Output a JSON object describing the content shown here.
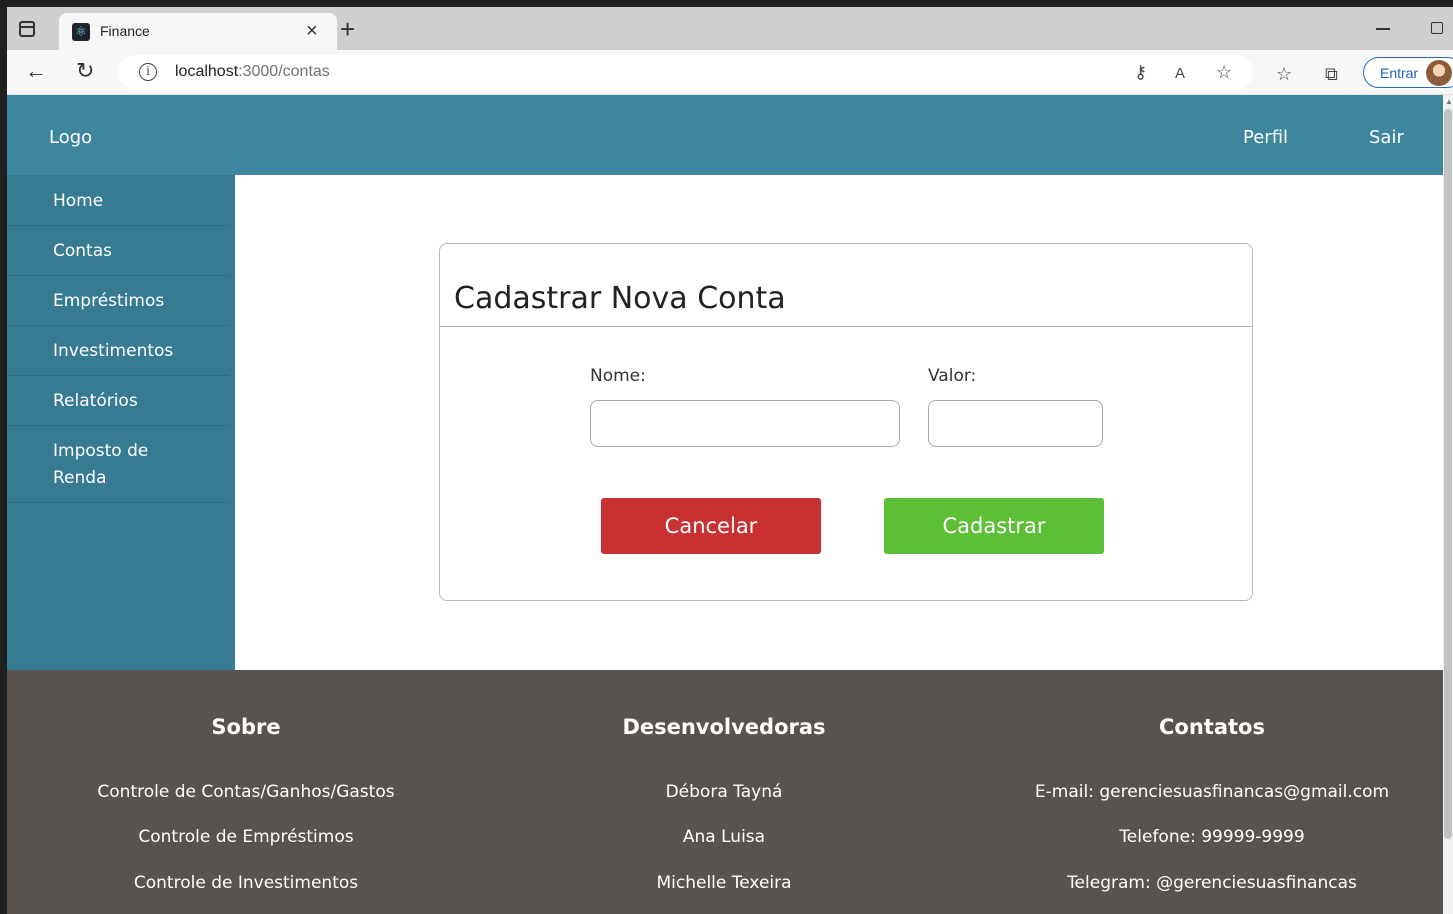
{
  "browser": {
    "tab_title": "Finance",
    "url_host": "localhost",
    "url_path": ":3000/contas",
    "signin_label": "Entrar"
  },
  "topbar": {
    "logo": "Logo",
    "profile_link": "Perfil",
    "logout_link": "Sair"
  },
  "sidebar": {
    "items": [
      {
        "label": "Home"
      },
      {
        "label": "Contas"
      },
      {
        "label": "Empréstimos"
      },
      {
        "label": "Investimentos"
      },
      {
        "label": "Relatórios"
      },
      {
        "label_line1": "Imposto de",
        "label_line2": "Renda"
      }
    ]
  },
  "form": {
    "title": "Cadastrar Nova Conta",
    "name_label": "Nome:",
    "name_value": "",
    "value_label": "Valor:",
    "value_value": "",
    "cancel_label": "Cancelar",
    "submit_label": "Cadastrar"
  },
  "footer": {
    "columns": [
      {
        "heading": "Sobre",
        "items": [
          "Controle de Contas/Ganhos/Gastos",
          "Controle de Empréstimos",
          "Controle de Investimentos"
        ]
      },
      {
        "heading": "Desenvolvedoras",
        "items": [
          "Débora Tayná",
          "Ana Luisa",
          "Michelle Texeira"
        ]
      },
      {
        "heading": "Contatos",
        "items": [
          "E-mail: gerenciesuasfinancas@gmail.com",
          "Telefone: 99999-9999",
          "Telegram: @gerenciesuasfinancas"
        ]
      }
    ]
  },
  "colors": {
    "header": "#3e859e",
    "sidebar": "#377b93",
    "footer": "#59534f",
    "cancel": "#c93032",
    "submit": "#5cbf35"
  }
}
